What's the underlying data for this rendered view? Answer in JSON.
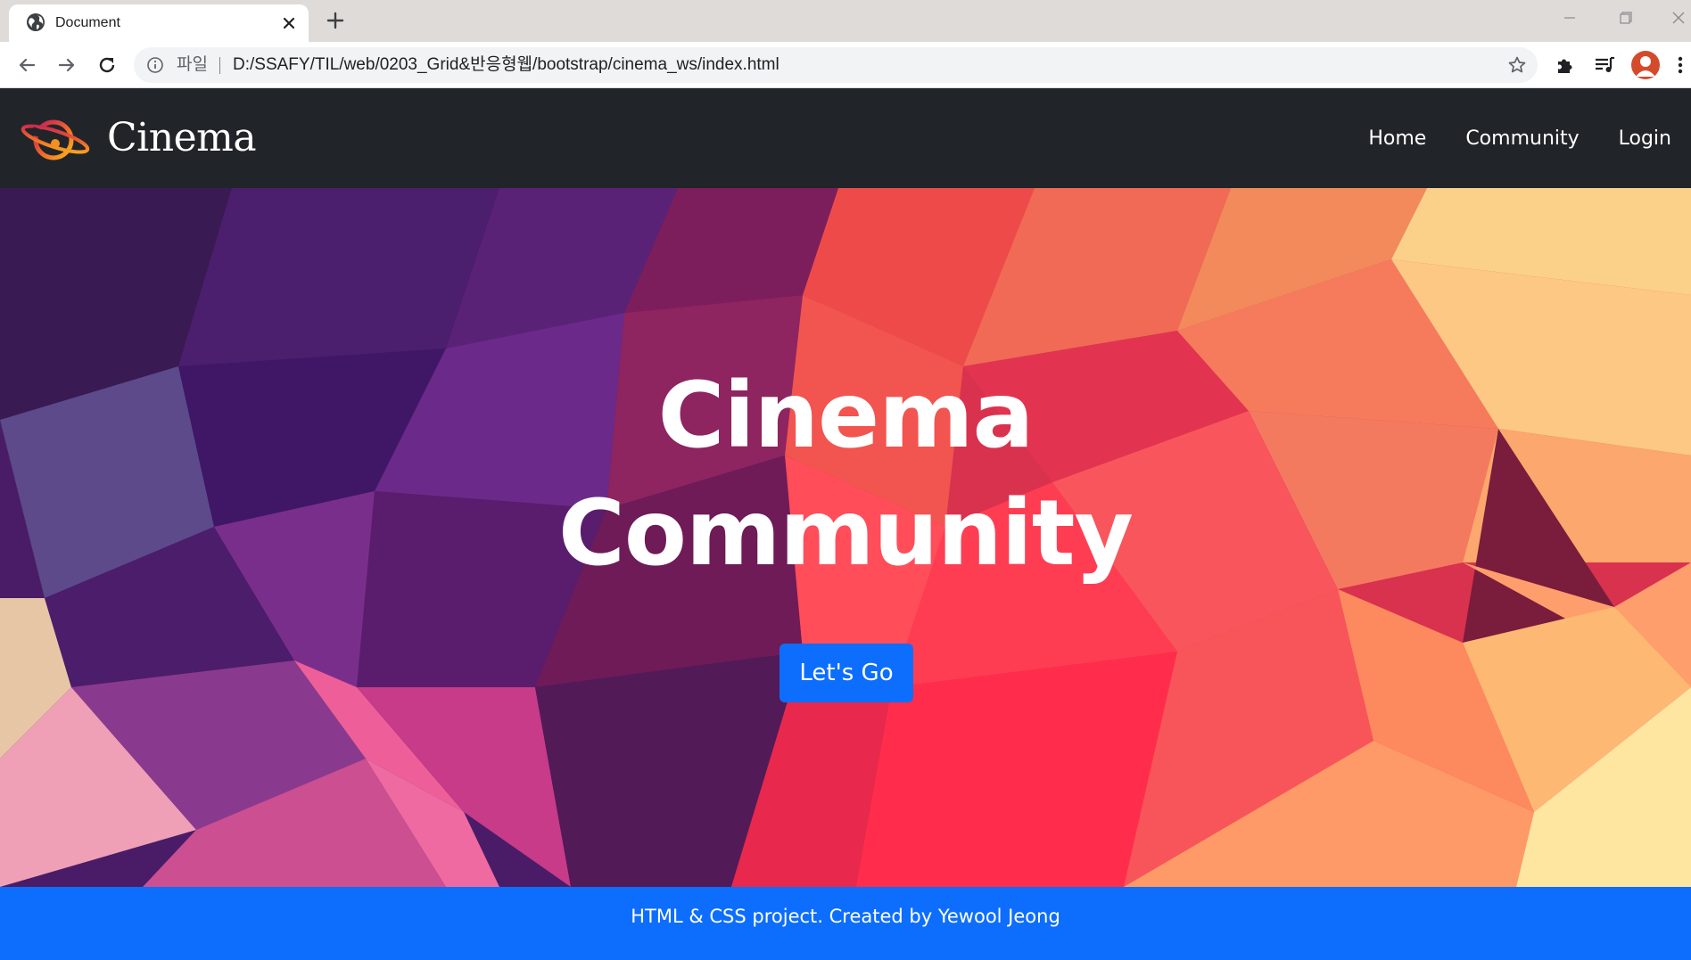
{
  "browser": {
    "tab_title": "Document",
    "omnibox": {
      "scheme_label": "파일",
      "url": "D:/SSAFY/TIL/web/0203_Grid&반응형웹/bootstrap/cinema_ws/index.html"
    }
  },
  "page": {
    "navbar": {
      "brand": "Cinema",
      "links": [
        "Home",
        "Community",
        "Login"
      ]
    },
    "hero": {
      "title_line1": "Cinema",
      "title_line2": "Community",
      "button_label": "Let's Go"
    },
    "footer": {
      "text": "HTML & CSS project. Created by Yewool Jeong"
    },
    "colors": {
      "navbar_bg": "#212529",
      "primary": "#0d6efd",
      "footer_bg": "#0d6efd"
    }
  },
  "icons": {
    "tab_favicon": "globe-icon",
    "tab_close": "close-icon",
    "new_tab": "plus-icon",
    "back": "arrow-left-icon",
    "forward": "arrow-right-icon",
    "reload": "reload-icon",
    "site_info": "info-icon",
    "bookmark": "star-icon",
    "extensions": "puzzle-icon",
    "media": "playlist-icon",
    "profile": "avatar",
    "menu": "kebab-icon"
  }
}
